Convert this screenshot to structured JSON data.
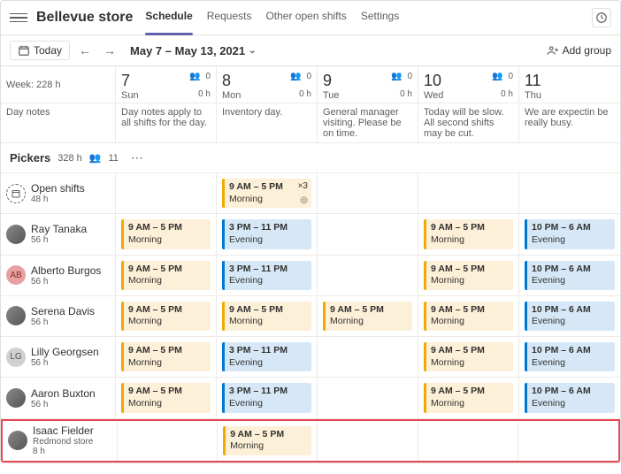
{
  "header": {
    "store_title": "Bellevue store",
    "tabs": [
      "Schedule",
      "Requests",
      "Other open shifts",
      "Settings"
    ],
    "active_tab": 0
  },
  "toolbar": {
    "today_label": "Today",
    "date_range": "May 7 – May 13, 2021",
    "add_group_label": "Add group"
  },
  "week_summary": {
    "label": "Week:",
    "hours": "228 h"
  },
  "day_notes_label": "Day notes",
  "days": [
    {
      "num": "7",
      "name": "Sun",
      "people": "0",
      "hours": "0 h",
      "note": "Day notes apply to all shifts for the day."
    },
    {
      "num": "8",
      "name": "Mon",
      "people": "0",
      "hours": "0 h",
      "note": "Inventory day."
    },
    {
      "num": "9",
      "name": "Tue",
      "people": "0",
      "hours": "0 h",
      "note": "General manager visiting. Please be on time."
    },
    {
      "num": "10",
      "name": "Wed",
      "people": "0",
      "hours": "0 h",
      "note": "Today will be slow. All second shifts may be cut."
    },
    {
      "num": "11",
      "name": "Thu",
      "people": "",
      "hours": "",
      "note": "We are expectin be really busy."
    }
  ],
  "group": {
    "name": "Pickers",
    "hours": "328 h",
    "people": "11"
  },
  "open_shifts": {
    "label": "Open shifts",
    "hours": "48 h"
  },
  "open_shift_block": {
    "time": "9 AM – 5 PM",
    "label": "Morning",
    "count": "×3"
  },
  "staff": [
    {
      "name": "Ray Tanaka",
      "hours": "56 h",
      "avatar_class": "photo",
      "shifts": [
        {
          "time": "9 AM – 5 PM",
          "label": "Morning",
          "type": "morning"
        },
        {
          "time": "3 PM – 11 PM",
          "label": "Evening",
          "type": "evening"
        },
        null,
        {
          "time": "9 AM – 5 PM",
          "label": "Morning",
          "type": "morning"
        },
        {
          "time": "10 PM – 6 AM",
          "label": "Evening",
          "type": "evening"
        }
      ]
    },
    {
      "name": "Alberto Burgos",
      "hours": "56 h",
      "avatar_class": "ab",
      "initials": "AB",
      "shifts": [
        {
          "time": "9 AM – 5 PM",
          "label": "Morning",
          "type": "morning"
        },
        {
          "time": "3 PM – 11 PM",
          "label": "Evening",
          "type": "evening"
        },
        null,
        {
          "time": "9 AM – 5 PM",
          "label": "Morning",
          "type": "morning"
        },
        {
          "time": "10 PM – 6 AM",
          "label": "Evening",
          "type": "evening"
        }
      ]
    },
    {
      "name": "Serena Davis",
      "hours": "56 h",
      "avatar_class": "photo",
      "shifts": [
        {
          "time": "9 AM – 5 PM",
          "label": "Morning",
          "type": "morning"
        },
        {
          "time": "9 AM – 5 PM",
          "label": "Morning",
          "type": "morning"
        },
        {
          "time": "9 AM – 5 PM",
          "label": "Morning",
          "type": "morning"
        },
        {
          "time": "9 AM – 5 PM",
          "label": "Morning",
          "type": "morning"
        },
        {
          "time": "10 PM – 6 AM",
          "label": "Evening",
          "type": "evening"
        }
      ]
    },
    {
      "name": "Lilly Georgsen",
      "hours": "56 h",
      "avatar_class": "lg",
      "initials": "LG",
      "shifts": [
        {
          "time": "9 AM – 5 PM",
          "label": "Morning",
          "type": "morning"
        },
        {
          "time": "3 PM – 11 PM",
          "label": "Evening",
          "type": "evening"
        },
        null,
        {
          "time": "9 AM – 5 PM",
          "label": "Morning",
          "type": "morning"
        },
        {
          "time": "10 PM – 6 AM",
          "label": "Evening",
          "type": "evening"
        }
      ]
    },
    {
      "name": "Aaron Buxton",
      "hours": "56 h",
      "avatar_class": "photo",
      "shifts": [
        {
          "time": "9 AM – 5 PM",
          "label": "Morning",
          "type": "morning"
        },
        {
          "time": "3 PM – 11 PM",
          "label": "Evening",
          "type": "evening"
        },
        null,
        {
          "time": "9 AM – 5 PM",
          "label": "Morning",
          "type": "morning"
        },
        {
          "time": "10 PM – 6 AM",
          "label": "Evening",
          "type": "evening"
        }
      ]
    }
  ],
  "highlighted_staff": {
    "name": "Isaac Fielder",
    "store": "Redmond store",
    "hours": "8 h",
    "avatar_class": "photo",
    "shifts": [
      null,
      {
        "time": "9 AM – 5 PM",
        "label": "Morning",
        "type": "morning"
      },
      null,
      null,
      null
    ]
  }
}
